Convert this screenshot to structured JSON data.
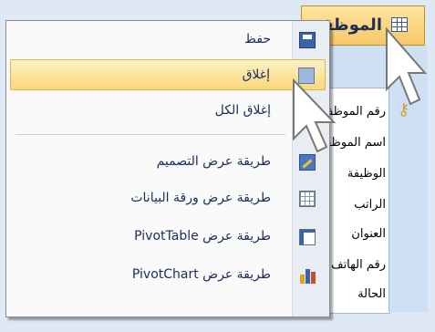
{
  "window": {
    "tab_title": "الموظفين",
    "fields": [
      "رقم الموظف",
      "اسم الموظف",
      "الوظيفة",
      "الراتب",
      "العنوان",
      "رقم الهاتف",
      "الحالة"
    ]
  },
  "menu": {
    "items": [
      {
        "label": "حفظ",
        "icon": "save-icon",
        "highlighted": false
      },
      {
        "label": "إغلاق",
        "icon": "close-icon",
        "highlighted": true
      },
      {
        "label": "إغلاق الكل",
        "icon": "close-all-icon",
        "highlighted": false
      },
      {
        "label": "طريقة عرض التصميم",
        "icon": "design-view-icon",
        "highlighted": false
      },
      {
        "label": "طريقة عرض ورقة البيانات",
        "icon": "datasheet-view-icon",
        "highlighted": false
      },
      {
        "label": "طريقة عرض PivotTable",
        "icon": "pivottable-view-icon",
        "highlighted": false
      },
      {
        "label": "طريقة عرض PivotChart",
        "icon": "pivotchart-view-icon",
        "highlighted": false
      }
    ]
  },
  "colors": {
    "highlight": "#fbd77a",
    "menu_text": "#1b2c5c",
    "tab": "#f6c766"
  }
}
